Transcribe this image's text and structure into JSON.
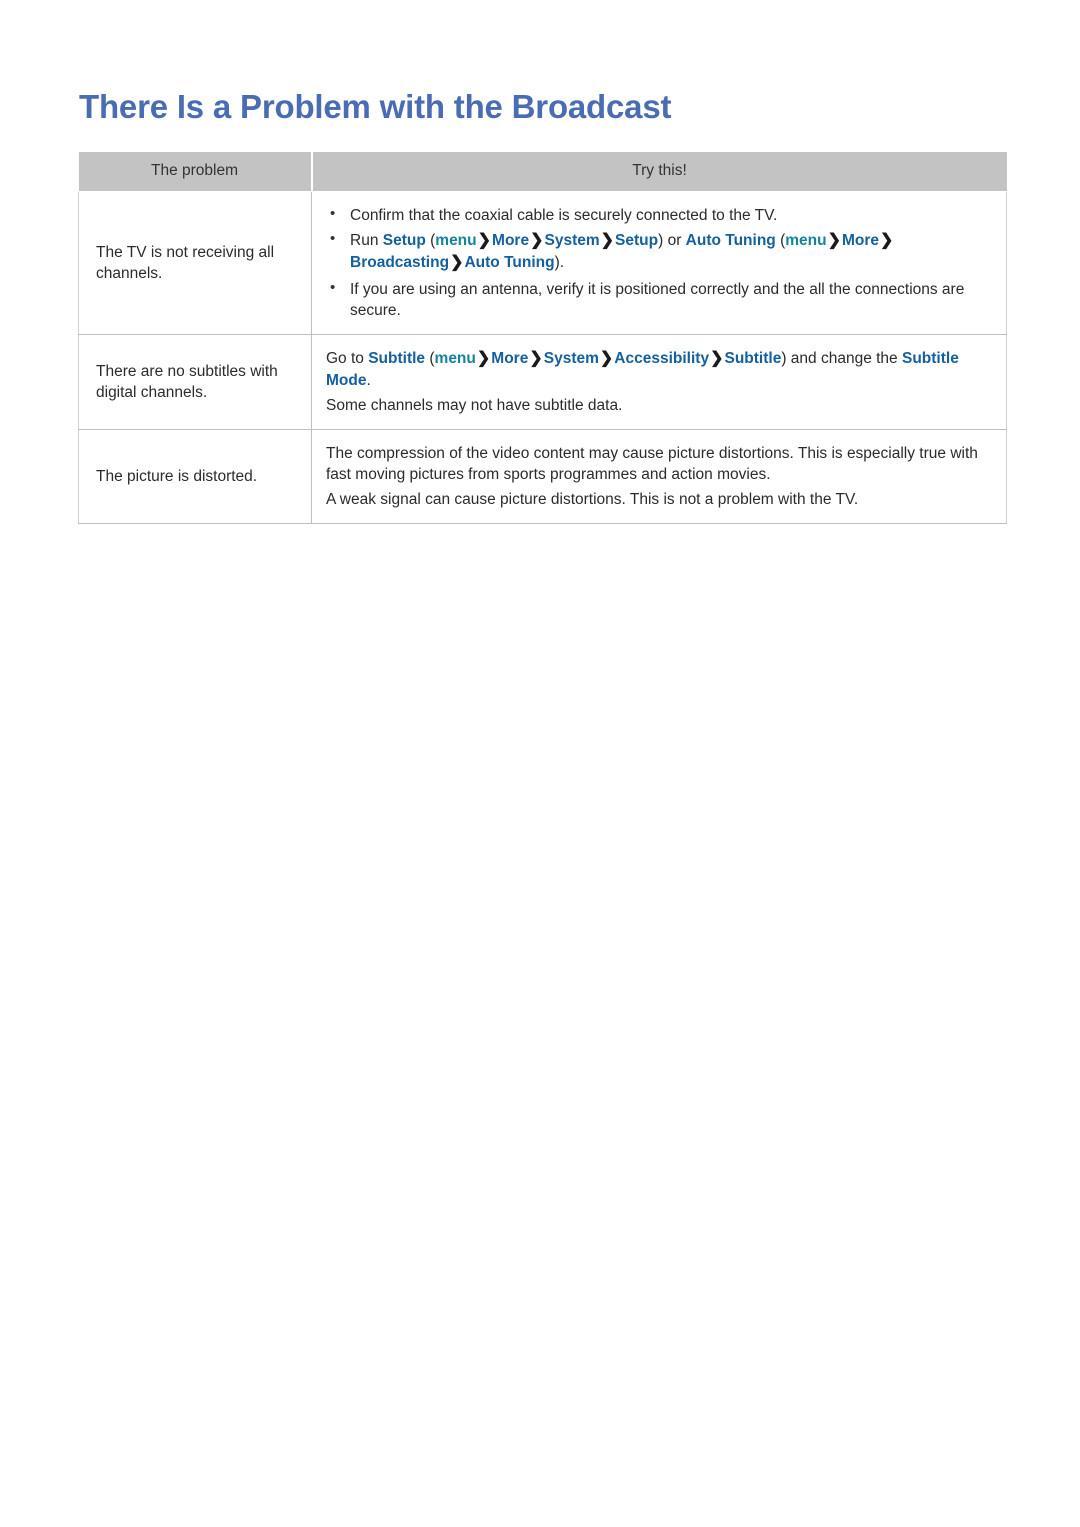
{
  "page": {
    "title": "There Is a Problem with the Broadcast"
  },
  "table": {
    "headers": {
      "problem": "The problem",
      "try_this": "Try this!"
    },
    "colors": {
      "title_blue": "#4a6cb3",
      "link_blue": "#14609f",
      "link_teal": "#14839c",
      "header_gray": "#c3c3c3",
      "body_text": "#2b2b2b"
    },
    "rows": [
      {
        "problem": "The TV is not receiving all channels.",
        "items": [
          {
            "kind": "bullet",
            "segments": [
              {
                "type": "plain",
                "text": "Confirm that the coaxial cable is securely connected to the TV."
              }
            ]
          },
          {
            "kind": "bullet",
            "segments": [
              {
                "type": "plain",
                "text": "Run "
              },
              {
                "type": "blue",
                "text": "Setup"
              },
              {
                "type": "plain",
                "text": " ("
              },
              {
                "type": "teal",
                "text": "menu"
              },
              {
                "type": "chev",
                "text": "❯"
              },
              {
                "type": "blue",
                "text": "More"
              },
              {
                "type": "chev",
                "text": "❯"
              },
              {
                "type": "blue",
                "text": "System"
              },
              {
                "type": "chev",
                "text": "❯"
              },
              {
                "type": "blue",
                "text": "Setup"
              },
              {
                "type": "plain",
                "text": ") or "
              },
              {
                "type": "blue",
                "text": "Auto Tuning"
              },
              {
                "type": "plain",
                "text": " ("
              },
              {
                "type": "teal",
                "text": "menu"
              },
              {
                "type": "chev",
                "text": "❯"
              },
              {
                "type": "blue",
                "text": "More"
              },
              {
                "type": "chev",
                "text": "❯"
              },
              {
                "type": "blue",
                "text": "Broadcasting"
              },
              {
                "type": "chev",
                "text": "❯"
              },
              {
                "type": "blue",
                "text": "Auto Tuning"
              },
              {
                "type": "plain",
                "text": ")."
              }
            ]
          },
          {
            "kind": "bullet",
            "segments": [
              {
                "type": "plain",
                "text": "If you are using an antenna, verify it is positioned correctly and the all the connections are secure."
              }
            ]
          }
        ]
      },
      {
        "problem": "There are no subtitles with digital channels.",
        "items": [
          {
            "kind": "para",
            "segments": [
              {
                "type": "plain",
                "text": "Go to "
              },
              {
                "type": "blue",
                "text": "Subtitle"
              },
              {
                "type": "plain",
                "text": " ("
              },
              {
                "type": "teal",
                "text": "menu"
              },
              {
                "type": "chev",
                "text": "❯"
              },
              {
                "type": "blue",
                "text": "More"
              },
              {
                "type": "chev",
                "text": "❯"
              },
              {
                "type": "blue",
                "text": "System"
              },
              {
                "type": "chev",
                "text": "❯"
              },
              {
                "type": "blue",
                "text": "Accessibility"
              },
              {
                "type": "chev",
                "text": "❯"
              },
              {
                "type": "blue",
                "text": "Subtitle"
              },
              {
                "type": "plain",
                "text": ") and change the "
              },
              {
                "type": "blue",
                "text": "Subtitle Mode"
              },
              {
                "type": "plain",
                "text": "."
              }
            ]
          },
          {
            "kind": "para",
            "segments": [
              {
                "type": "plain",
                "text": "Some channels may not have subtitle data."
              }
            ]
          }
        ]
      },
      {
        "problem": "The picture is distorted.",
        "items": [
          {
            "kind": "para",
            "segments": [
              {
                "type": "plain",
                "text": "The compression of the video content may cause picture distortions. This is especially true with fast moving pictures from sports programmes and action movies."
              }
            ]
          },
          {
            "kind": "para",
            "segments": [
              {
                "type": "plain",
                "text": "A weak signal can cause picture distortions. This is not a problem with the TV."
              }
            ]
          }
        ]
      }
    ]
  }
}
